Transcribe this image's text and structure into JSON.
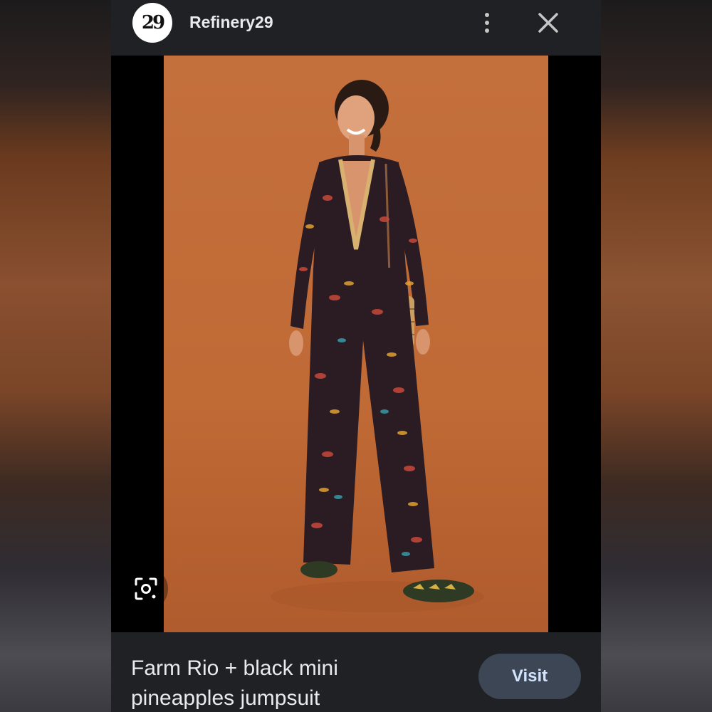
{
  "header": {
    "logo_text": "29",
    "source_name": "Refinery29",
    "more_icon": "more-vert-icon",
    "close_icon": "close-icon"
  },
  "image": {
    "description_icon": "lens-icon"
  },
  "footer": {
    "title": "Farm Rio + black mini pineapples jumpsuit",
    "visit_label": "Visit"
  },
  "colors": {
    "panel_bg": "#202124",
    "photo_bg": "#c4703c",
    "button_bg": "#3c4654",
    "button_text": "#d3e3fd"
  }
}
